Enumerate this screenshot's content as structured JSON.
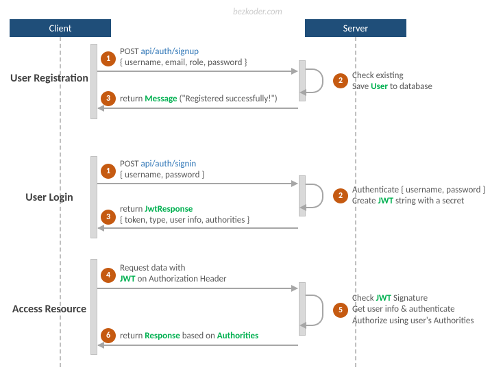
{
  "watermark": "bezkoder.com",
  "lanes": {
    "client": "Client",
    "server": "Server"
  },
  "sections": {
    "registration": "User Registration",
    "login": "User Login",
    "access": "Access Resource"
  },
  "reg": {
    "step1_prefix": "POST ",
    "step1_endpoint": "api/auth/signup",
    "step1_body": "{ username, email, role, password }",
    "step2_line1": "Check existing",
    "step2_line2_a": "Save ",
    "step2_line2_b": "User",
    "step2_line2_c": " to database",
    "step3_a": "return ",
    "step3_b": "Message",
    "step3_c": " (\"Registered successfully!\")"
  },
  "login": {
    "step1_prefix": "POST ",
    "step1_endpoint": "api/auth/signin",
    "step1_body": "{ username, password }",
    "step2_line1": "Authenticate { username, password }",
    "step2_line2_a": "Create ",
    "step2_line2_b": "JWT",
    "step2_line2_c": " string with a secret",
    "step3_a": "return ",
    "step3_b": "JwtResponse",
    "step3_body": "{ token, type, user info, authorities }"
  },
  "access": {
    "step4_line1": "Request  data with",
    "step4_line2_b": "JWT",
    "step4_line2_c": " on Authorization Header",
    "step5_line1_a": "Check ",
    "step5_line1_b": "JWT",
    "step5_line1_c": " Signature",
    "step5_line2": "Get user info & authenticate",
    "step5_line3": "Authorize using user's Authorities",
    "step6_a": "return ",
    "step6_b": "Response",
    "step6_c": " based on ",
    "step6_d": "Authorities"
  },
  "nums": {
    "n1": "1",
    "n2": "2",
    "n3": "3",
    "n4": "4",
    "n5": "5",
    "n6": "6"
  }
}
